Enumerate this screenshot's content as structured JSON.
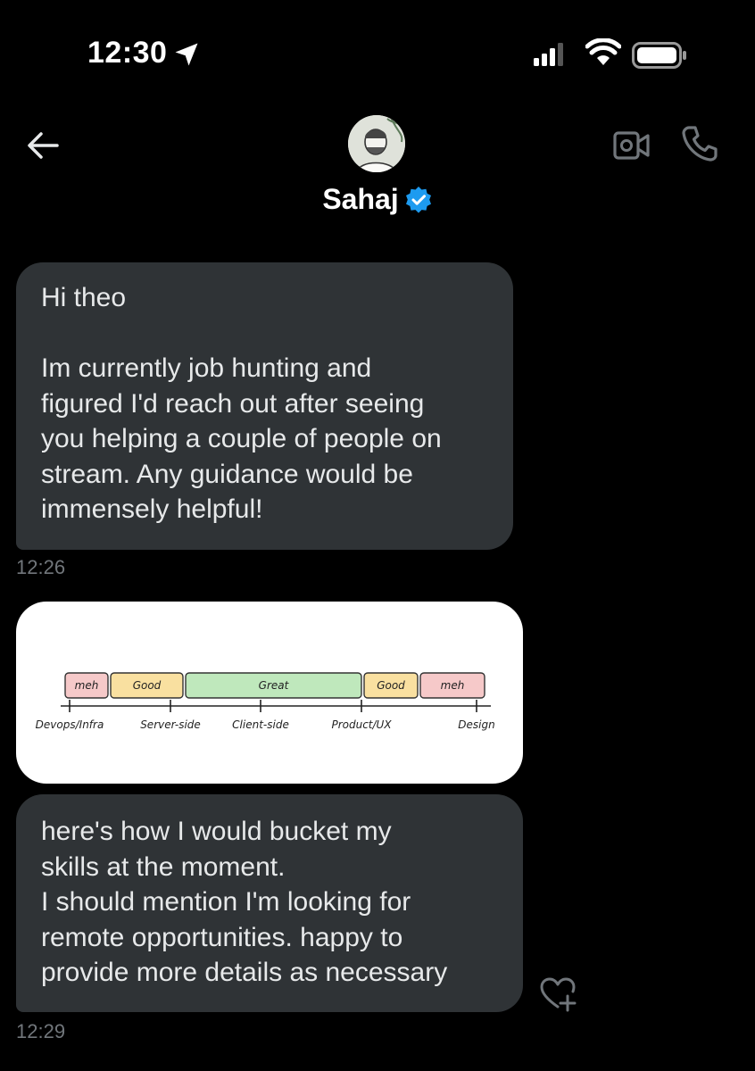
{
  "status_bar": {
    "time": "12:30"
  },
  "header": {
    "contact_name": "Sahaj",
    "verified": true,
    "icons": [
      "back-arrow-icon",
      "video-call-icon",
      "phone-icon",
      "verified-badge-icon"
    ]
  },
  "messages": [
    {
      "paragraphs": [
        "Hi theo",
        "",
        "Im currently job hunting and",
        "figured I'd reach out after seeing",
        "you helping a couple of people on",
        "stream. Any guidance would be",
        "immensely helpful!"
      ],
      "time": "12:26"
    },
    {
      "type": "image"
    },
    {
      "lines": [
        "here's how I would bucket my",
        "skills at the moment.",
        "I should mention I'm looking for",
        "remote opportunities. happy to",
        "provide more details as necessary"
      ],
      "time": "12:29"
    }
  ],
  "chart_data": {
    "type": "table",
    "buckets": [
      {
        "label": "meh",
        "color": "#f6c9c9"
      },
      {
        "label": "Good",
        "color": "#f9e0a0"
      },
      {
        "label": "Great",
        "color": "#bfe8bc"
      },
      {
        "label": "Good",
        "color": "#f9e0a0"
      },
      {
        "label": "meh",
        "color": "#f6c9c9"
      }
    ],
    "axis_labels": [
      "Devops/Infra",
      "Server-side",
      "Client-side",
      "Product/UX",
      "Design"
    ]
  },
  "colors": {
    "bubble": "#2f3336",
    "timestamp": "#71767b",
    "verified": "#1d9bf0"
  }
}
